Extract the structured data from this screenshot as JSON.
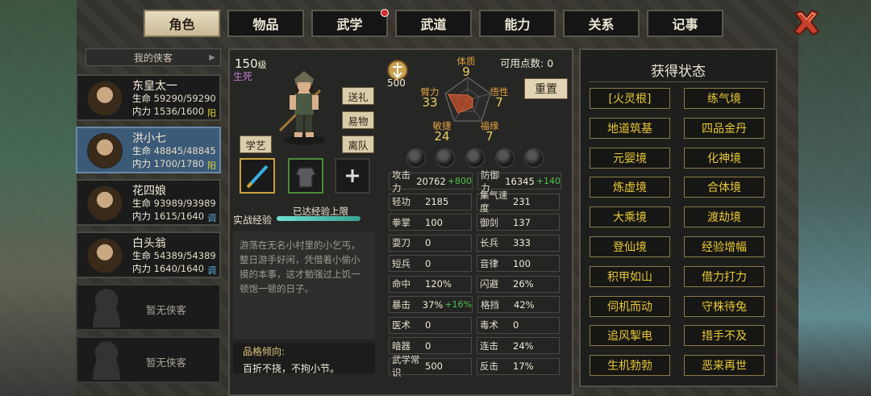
{
  "tabs": [
    {
      "label": "角色",
      "active": true
    },
    {
      "label": "物品"
    },
    {
      "label": "武学",
      "badge": true
    },
    {
      "label": "武道"
    },
    {
      "label": "能力"
    },
    {
      "label": "关系"
    },
    {
      "label": "记事"
    }
  ],
  "list": {
    "header": "我的侠客",
    "characters": [
      {
        "name": "东皇太一",
        "hp_label": "生命",
        "hp": "59290/59290",
        "mp_label": "内力",
        "mp": "1536/1600",
        "tag": "阳"
      },
      {
        "name": "洪小七",
        "hp_label": "生命",
        "hp": "48845/48845",
        "mp_label": "内力",
        "mp": "1700/1780",
        "tag": "阳"
      },
      {
        "name": "花四娘",
        "hp_label": "生命",
        "hp": "93989/93989",
        "mp_label": "内力",
        "mp": "1615/1640",
        "tag": "调"
      },
      {
        "name": "白头翁",
        "hp_label": "生命",
        "hp": "54389/54389",
        "mp_label": "内力",
        "mp": "1640/1640",
        "tag": "调"
      }
    ],
    "empty_label": "暂无侠客"
  },
  "hero": {
    "level": "150",
    "level_unit": "级",
    "state": "生死",
    "buttons": [
      "送礼",
      "易物",
      "离队"
    ],
    "skill_btn": "学艺",
    "exp_label": "实战经验",
    "exp_text": "已达经验上限",
    "exp_progress": 1.0,
    "description": "游荡在无名小村里的小乞丐，整日游手好闲，凭借着小偷小摸的本事，这才勉强过上饥一顿饱一顿的日子。",
    "trait_title": "品格倾向:",
    "trait_text": "百折不挠，不拘小节。"
  },
  "attributes": {
    "points": "500",
    "available_label": "可用点数:",
    "available_value": "0",
    "reset_label": "重置",
    "radar": [
      {
        "label": "体质",
        "value": "9"
      },
      {
        "label": "悟性",
        "value": "7"
      },
      {
        "label": "福缘",
        "value": "7"
      },
      {
        "label": "敏捷",
        "value": "24"
      },
      {
        "label": "臂力",
        "value": "33"
      }
    ]
  },
  "stats": [
    [
      {
        "k": "攻击力",
        "v": "20762",
        "bonus": "+800"
      },
      {
        "k": "防御力",
        "v": "16345",
        "bonus": "+140"
      }
    ],
    [
      {
        "k": "轻功",
        "v": "2185"
      },
      {
        "k": "集气速度",
        "v": "231"
      }
    ],
    [
      {
        "k": "拳掌",
        "v": "100"
      },
      {
        "k": "御剑",
        "v": "137"
      }
    ],
    [
      {
        "k": "耍刀",
        "v": "0"
      },
      {
        "k": "长兵",
        "v": "333"
      }
    ],
    [
      {
        "k": "短兵",
        "v": "0"
      },
      {
        "k": "音律",
        "v": "100"
      }
    ],
    [
      {
        "k": "命中",
        "v": "120%"
      },
      {
        "k": "闪避",
        "v": "26%"
      }
    ],
    [
      {
        "k": "暴击",
        "v": "37%",
        "bonus": "+16%"
      },
      {
        "k": "格挡",
        "v": "42%"
      }
    ],
    [
      {
        "k": "医术",
        "v": "0"
      },
      {
        "k": "毒术",
        "v": "0"
      }
    ],
    [
      {
        "k": "暗器",
        "v": "0"
      },
      {
        "k": "连击",
        "v": "24%"
      }
    ],
    [
      {
        "k": "武学常识",
        "v": "500"
      },
      {
        "k": "反击",
        "v": "17%"
      }
    ]
  ],
  "status_panel": {
    "title": "获得状态",
    "items": [
      "[火灵根]",
      "练气境",
      "地道筑基",
      "四品金丹",
      "元婴境",
      "化神境",
      "炼虚境",
      "合体境",
      "大乘境",
      "渡劫境",
      "登仙境",
      "经验增幅",
      "积甲如山",
      "借力打力",
      "伺机而动",
      "守株待兔",
      "追风掣电",
      "措手不及",
      "生机勃勃",
      "恶来再世"
    ]
  },
  "colors": {
    "accent_gold": "#e8c838",
    "active_blue": "#3b5a78",
    "bonus_green": "#4ec24e",
    "radar_label": "#e0a040"
  }
}
